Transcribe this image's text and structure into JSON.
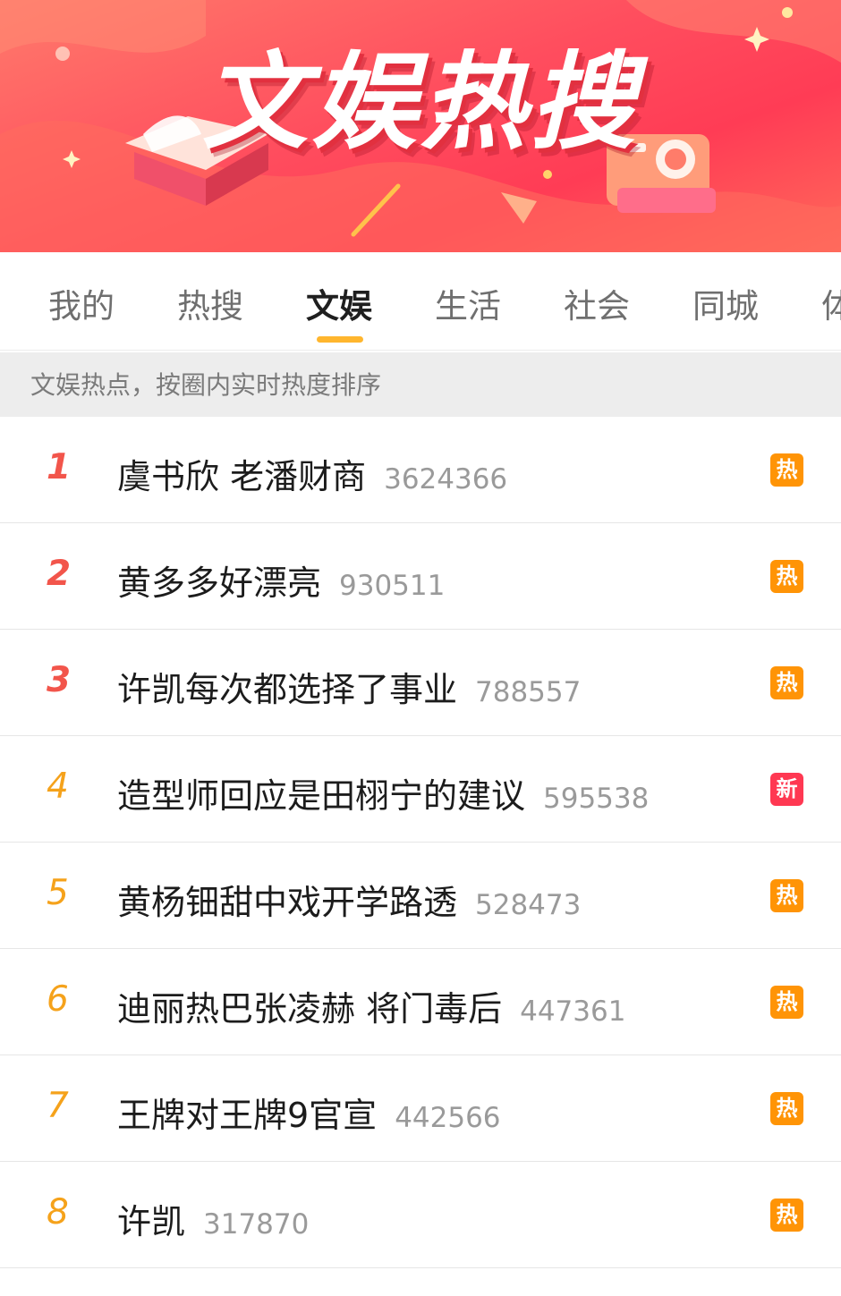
{
  "banner": {
    "title": "文娱热搜"
  },
  "tabs": [
    {
      "label": "我的"
    },
    {
      "label": "热搜"
    },
    {
      "label": "文娱",
      "active": true
    },
    {
      "label": "生活"
    },
    {
      "label": "社会"
    },
    {
      "label": "同城"
    },
    {
      "label": "体"
    }
  ],
  "subheader": "文娱热点，按圈内实时热度排序",
  "items": [
    {
      "rank": "1",
      "title": "虞书欣 老潘财商",
      "count": "3624366",
      "badge": "热"
    },
    {
      "rank": "2",
      "title": "黄多多好漂亮",
      "count": "930511",
      "badge": "热"
    },
    {
      "rank": "3",
      "title": "许凯每次都选择了事业",
      "count": "788557",
      "badge": "热"
    },
    {
      "rank": "4",
      "title": "造型师回应是田栩宁的建议",
      "count": "595538",
      "badge": "新"
    },
    {
      "rank": "5",
      "title": "黄杨钿甜中戏开学路透",
      "count": "528473",
      "badge": "热"
    },
    {
      "rank": "6",
      "title": "迪丽热巴张凌赫 将门毒后",
      "count": "447361",
      "badge": "热"
    },
    {
      "rank": "7",
      "title": "王牌对王牌9官宣",
      "count": "442566",
      "badge": "热"
    },
    {
      "rank": "8",
      "title": "许凯",
      "count": "317870",
      "badge": "热"
    }
  ],
  "colors": {
    "banner": "#ff4d5e",
    "tab_indicator": "#ffb62e",
    "rank_top": "#f2554b",
    "rank_other": "#f5a21b",
    "badge_hot": "#ff9406",
    "badge_new": "#ff3852"
  }
}
